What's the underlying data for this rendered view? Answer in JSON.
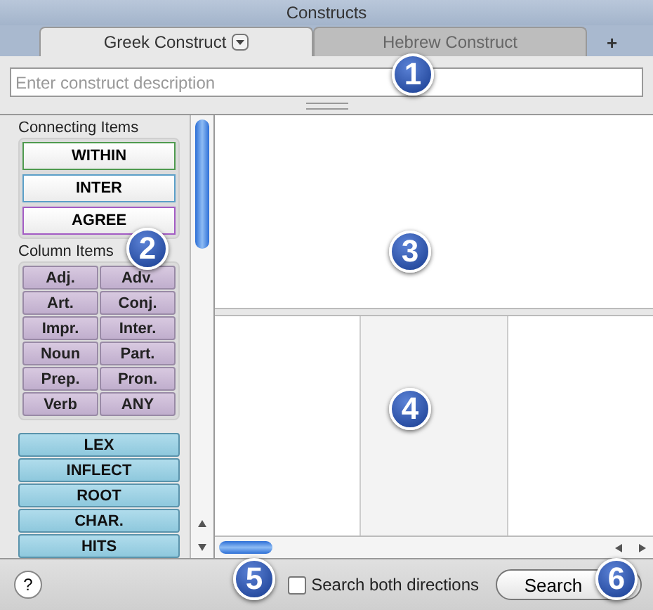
{
  "window": {
    "title": "Constructs"
  },
  "tabs": [
    {
      "label": "Greek Construct",
      "selected": true,
      "menu": true
    },
    {
      "label": "Hebrew Construct",
      "selected": false,
      "menu": false
    }
  ],
  "add_tab": "+",
  "description": {
    "placeholder": "Enter construct description"
  },
  "connecting": {
    "title": "Connecting Items",
    "items": [
      {
        "label": "WITHIN",
        "color": "#4f9a4f"
      },
      {
        "label": "INTER",
        "color": "#5b9fc8"
      },
      {
        "label": "AGREE",
        "color": "#a35cc4"
      }
    ]
  },
  "column": {
    "title": "Column Items",
    "items": [
      "Adj.",
      "Adv.",
      "Art.",
      "Conj.",
      "Impr.",
      "Inter.",
      "Noun",
      "Part.",
      "Prep.",
      "Pron.",
      "Verb",
      "ANY"
    ]
  },
  "extra_items": [
    "LEX",
    "INFLECT",
    "ROOT",
    "CHAR.",
    "HITS"
  ],
  "search_both": {
    "label": "Search both directions",
    "checked": false
  },
  "search_button": "Search",
  "help": "?",
  "callouts": [
    "1",
    "2",
    "3",
    "4",
    "5",
    "6"
  ]
}
